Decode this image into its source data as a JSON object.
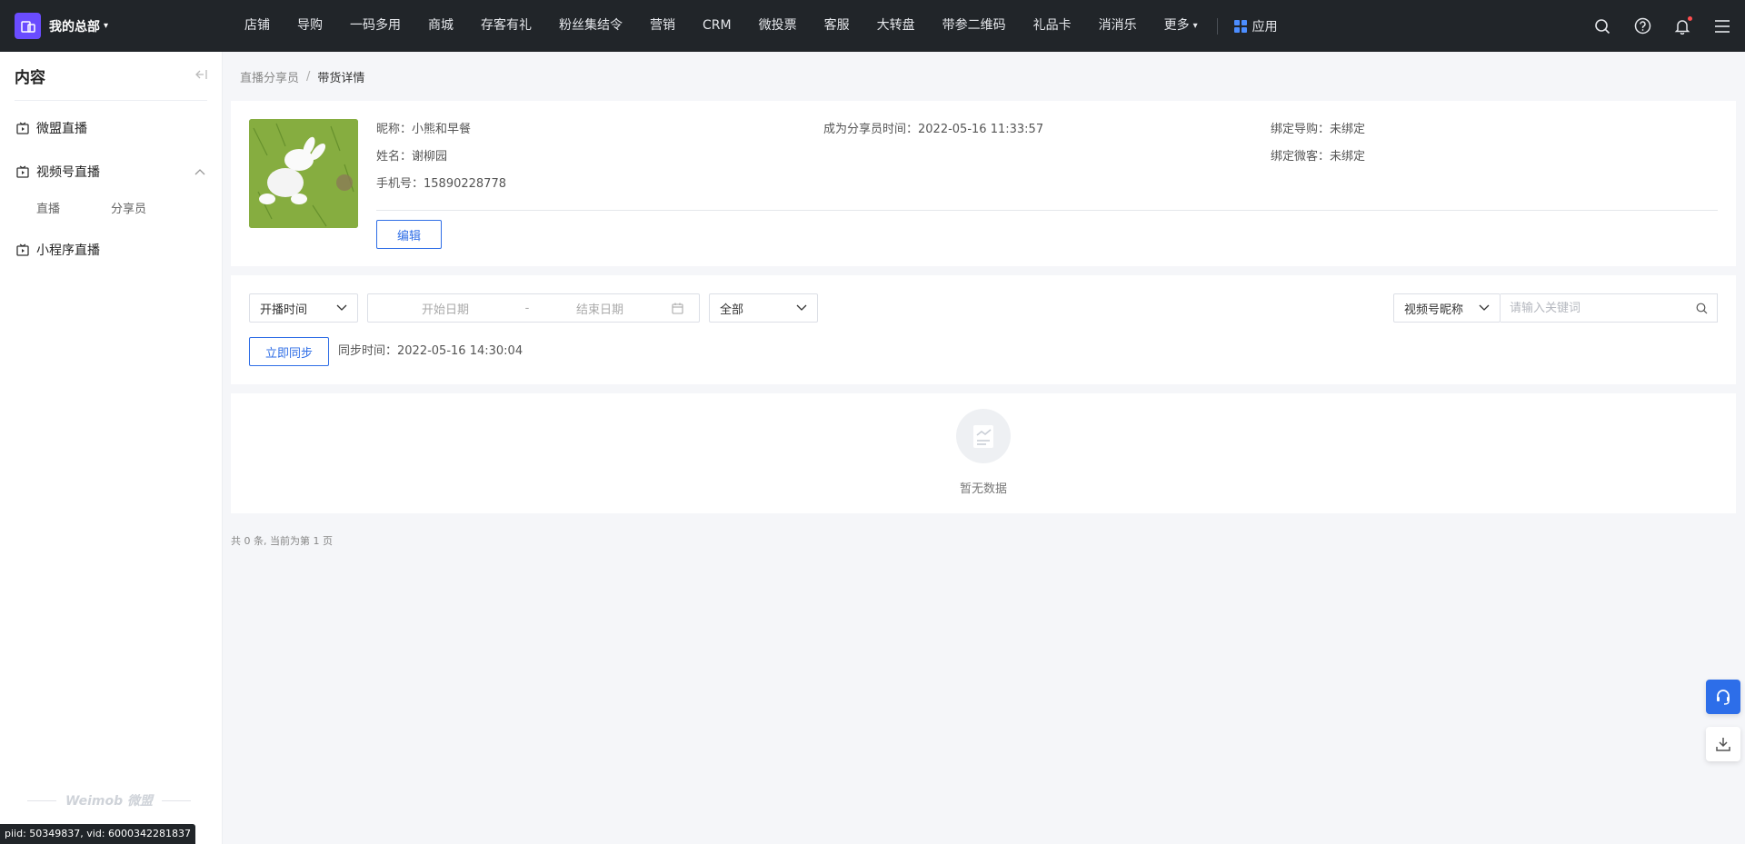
{
  "brand": {
    "name": "我的总部"
  },
  "nav": {
    "items": [
      "店铺",
      "导购",
      "一码多用",
      "商城",
      "存客有礼",
      "粉丝集结令",
      "营销",
      "CRM",
      "微投票",
      "客服",
      "大转盘",
      "带参二维码",
      "礼品卡",
      "消消乐"
    ],
    "more": "更多",
    "app": "应用"
  },
  "sidebar": {
    "title": "内容",
    "groups": [
      {
        "label": "微盟直播"
      },
      {
        "label": "视频号直播",
        "subs": [
          "直播",
          "分享员"
        ]
      },
      {
        "label": "小程序直播"
      }
    ],
    "footer_logo": "Weimob 微盟"
  },
  "debug": "piid: 50349837, vid: 6000342281837",
  "breadcrumb": {
    "parent": "直播分享员",
    "sep": "/",
    "current": "带货详情"
  },
  "profile": {
    "nickname_label": "昵称：",
    "nickname": "小熊和早餐",
    "name_label": "姓名：",
    "name": "谢柳园",
    "phone_label": "手机号：",
    "phone": "15890228778",
    "joined_label": "成为分享员时间：",
    "joined": "2022-05-16 11:33:57",
    "guide_label": "绑定导购：",
    "guide": "未绑定",
    "customer_label": "绑定微客：",
    "customer": "未绑定",
    "edit_label": "编辑"
  },
  "filters": {
    "time_type": "开播时间",
    "start_placeholder": "开始日期",
    "range_sep": "-",
    "end_placeholder": "结束日期",
    "status": "全部",
    "search_field": "视频号昵称",
    "search_placeholder": "请输入关键词",
    "sync_label": "立即同步",
    "sync_time_label": "同步时间：",
    "sync_time": "2022-05-16 14:30:04"
  },
  "empty": {
    "text": "暂无数据"
  },
  "pagination": {
    "text": "共 0 条, 当前为第 1 页"
  },
  "colors": {
    "topbar": "#212529",
    "brand": "#6a4cff",
    "accent": "#2f6ee6",
    "float": "#2d6ee9"
  }
}
